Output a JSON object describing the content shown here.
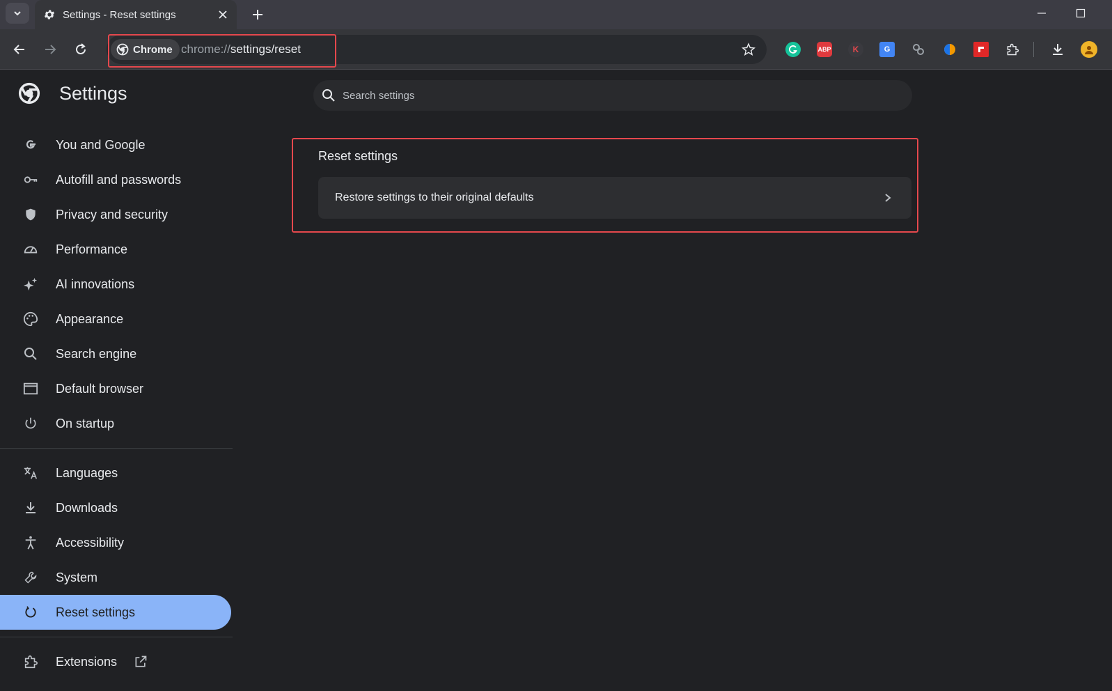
{
  "tab": {
    "title": "Settings - Reset settings"
  },
  "omnibox": {
    "chip_label": "Chrome",
    "url_scheme": "chrome://",
    "url_path": "settings/reset"
  },
  "extensions": [
    {
      "name": "grammarly-icon",
      "color": "#15c39a",
      "text": ""
    },
    {
      "name": "adblock-plus-icon",
      "color": "#e03a3e",
      "text": "ABP"
    },
    {
      "name": "k-extension-icon",
      "color": "#5a3a3a",
      "text": "K"
    },
    {
      "name": "google-translate-icon",
      "color": "#4285f4",
      "text": "G"
    },
    {
      "name": "link-extension-icon",
      "color": "#9aa0a6",
      "text": ""
    },
    {
      "name": "color-extension-icon",
      "color": "#f29900",
      "text": ""
    },
    {
      "name": "flipboard-icon",
      "color": "#e12828",
      "text": ""
    }
  ],
  "settings": {
    "title": "Settings",
    "search_placeholder": "Search settings"
  },
  "sidebar": {
    "items": [
      {
        "label": "You and Google",
        "icon": "google-g-icon"
      },
      {
        "label": "Autofill and passwords",
        "icon": "key-icon"
      },
      {
        "label": "Privacy and security",
        "icon": "shield-icon"
      },
      {
        "label": "Performance",
        "icon": "speedometer-icon"
      },
      {
        "label": "AI innovations",
        "icon": "sparkle-icon"
      },
      {
        "label": "Appearance",
        "icon": "palette-icon"
      },
      {
        "label": "Search engine",
        "icon": "search-icon"
      },
      {
        "label": "Default browser",
        "icon": "browser-window-icon"
      },
      {
        "label": "On startup",
        "icon": "power-icon"
      }
    ],
    "items2": [
      {
        "label": "Languages",
        "icon": "translate-icon"
      },
      {
        "label": "Downloads",
        "icon": "download-icon"
      },
      {
        "label": "Accessibility",
        "icon": "accessibility-icon"
      },
      {
        "label": "System",
        "icon": "wrench-icon"
      },
      {
        "label": "Reset settings",
        "icon": "reset-icon",
        "active": true
      }
    ],
    "extensions_label": "Extensions"
  },
  "main": {
    "section_title": "Reset settings",
    "row_label": "Restore settings to their original defaults"
  },
  "colors": {
    "highlight": "#e5484d",
    "accent": "#8ab4f8",
    "background": "#202124"
  }
}
